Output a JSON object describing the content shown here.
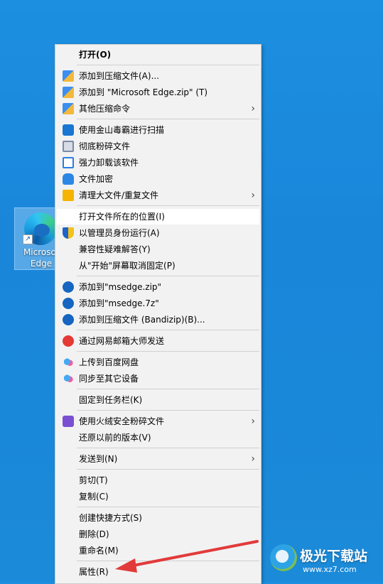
{
  "desktop": {
    "icon_label": "Microsoft Edge",
    "icon_label_visible": "Microsof\nEdge"
  },
  "menu": {
    "items": [
      {
        "label": "打开(O)",
        "icon": "none"
      },
      {
        "label": "添加到压缩文件(A)...",
        "icon": "archive-icon"
      },
      {
        "label": "添加到 \"Microsoft Edge.zip\" (T)",
        "icon": "archive-icon"
      },
      {
        "label": "其他压缩命令",
        "icon": "archive-icon",
        "submenu": true
      },
      {
        "label": "使用金山毒霸进行扫描",
        "icon": "duba-icon"
      },
      {
        "label": "彻底粉碎文件",
        "icon": "shredder-icon"
      },
      {
        "label": "强力卸载该软件",
        "icon": "uninstall-icon"
      },
      {
        "label": "文件加密",
        "icon": "encrypt-icon"
      },
      {
        "label": "清理大文件/重复文件",
        "icon": "cleanup-icon",
        "submenu": true
      },
      {
        "label": "打开文件所在的位置(I)",
        "icon": "none"
      },
      {
        "label": "以管理员身份运行(A)",
        "icon": "uac-shield-icon"
      },
      {
        "label": "兼容性疑难解答(Y)",
        "icon": "none"
      },
      {
        "label": "从\"开始\"屏幕取消固定(P)",
        "icon": "none"
      },
      {
        "label": "添加到\"msedge.zip\"",
        "icon": "bandizip-icon"
      },
      {
        "label": "添加到\"msedge.7z\"",
        "icon": "bandizip-icon"
      },
      {
        "label": "添加到压缩文件 (Bandizip)(B)...",
        "icon": "bandizip-icon"
      },
      {
        "label": "通过网易邮箱大师发送",
        "icon": "netease-mail-icon"
      },
      {
        "label": "上传到百度网盘",
        "icon": "baidu-cloud-icon"
      },
      {
        "label": "同步至其它设备",
        "icon": "baidu-cloud-icon"
      },
      {
        "label": "固定到任务栏(K)",
        "icon": "none"
      },
      {
        "label": "使用火绒安全粉碎文件",
        "icon": "huorong-icon",
        "submenu": true
      },
      {
        "label": "还原以前的版本(V)",
        "icon": "none"
      },
      {
        "label": "发送到(N)",
        "icon": "none",
        "submenu": true
      },
      {
        "label": "剪切(T)",
        "icon": "none"
      },
      {
        "label": "复制(C)",
        "icon": "none"
      },
      {
        "label": "创建快捷方式(S)",
        "icon": "none"
      },
      {
        "label": "删除(D)",
        "icon": "none"
      },
      {
        "label": "重命名(M)",
        "icon": "none"
      },
      {
        "label": "属性(R)",
        "icon": "none"
      }
    ]
  },
  "watermark": {
    "title": "极光下载站",
    "url": "www.xz7.com"
  },
  "colors": {
    "desktop": "#1b8ad8",
    "menu_bg": "#f2f2f2",
    "hover_bg": "#ffffff",
    "arrow": "#e23a3a"
  }
}
